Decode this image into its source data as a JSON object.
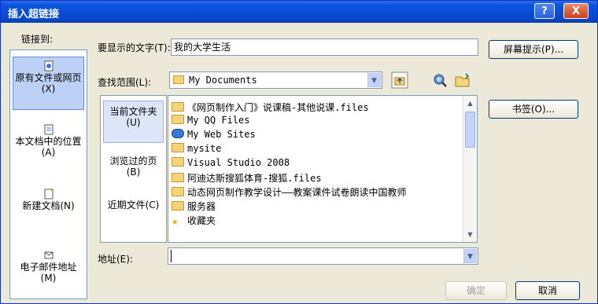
{
  "window": {
    "title": "插入超链接",
    "help_glyph": "?",
    "close_glyph": "X"
  },
  "left": {
    "label": "链接到:",
    "items": [
      {
        "label": "原有文件或网页(X)",
        "icon": "existing-file-icon"
      },
      {
        "label": "本文档中的位置(A)",
        "icon": "place-in-document-icon"
      },
      {
        "label": "新建文档(N)",
        "icon": "new-document-icon"
      },
      {
        "label": "电子邮件地址(M)",
        "icon": "email-address-icon"
      }
    ]
  },
  "display_text": {
    "label": "要显示的文字(T):",
    "value": "我的大学生活"
  },
  "screentip_button": "屏幕提示(P)...",
  "lookin": {
    "label": "查找范围(L):",
    "value": "My Documents"
  },
  "bookmark_button": "书签(O)...",
  "locations": [
    {
      "label": "当前文件夹(U)"
    },
    {
      "label": "浏览过的页(B)"
    },
    {
      "label": "近期文件(C)"
    }
  ],
  "files": [
    {
      "name": "《网页制作入门》说课稿-其他说课.files",
      "icon": "folder-icon"
    },
    {
      "name": "My QQ Files",
      "icon": "folder-icon"
    },
    {
      "name": "My Web Sites",
      "icon": "web-folder-icon"
    },
    {
      "name": "mysite",
      "icon": "folder-icon"
    },
    {
      "name": "Visual Studio 2008",
      "icon": "folder-icon"
    },
    {
      "name": "阿迪达斯搜狐体育-搜狐.files",
      "icon": "folder-icon"
    },
    {
      "name": "动态网页制作教学设计——教案课件试卷朗读中国教师",
      "icon": "folder-icon"
    },
    {
      "name": "服务器",
      "icon": "folder-icon"
    },
    {
      "name": "收藏夹",
      "icon": "favorites-star-icon"
    }
  ],
  "address": {
    "label": "地址(E):",
    "value": ""
  },
  "ok_button": "确定",
  "cancel_button": "取消",
  "colors": {
    "titlebar": "#0a55e0",
    "selection": "#bcd1f5",
    "face": "#ece9d8"
  }
}
